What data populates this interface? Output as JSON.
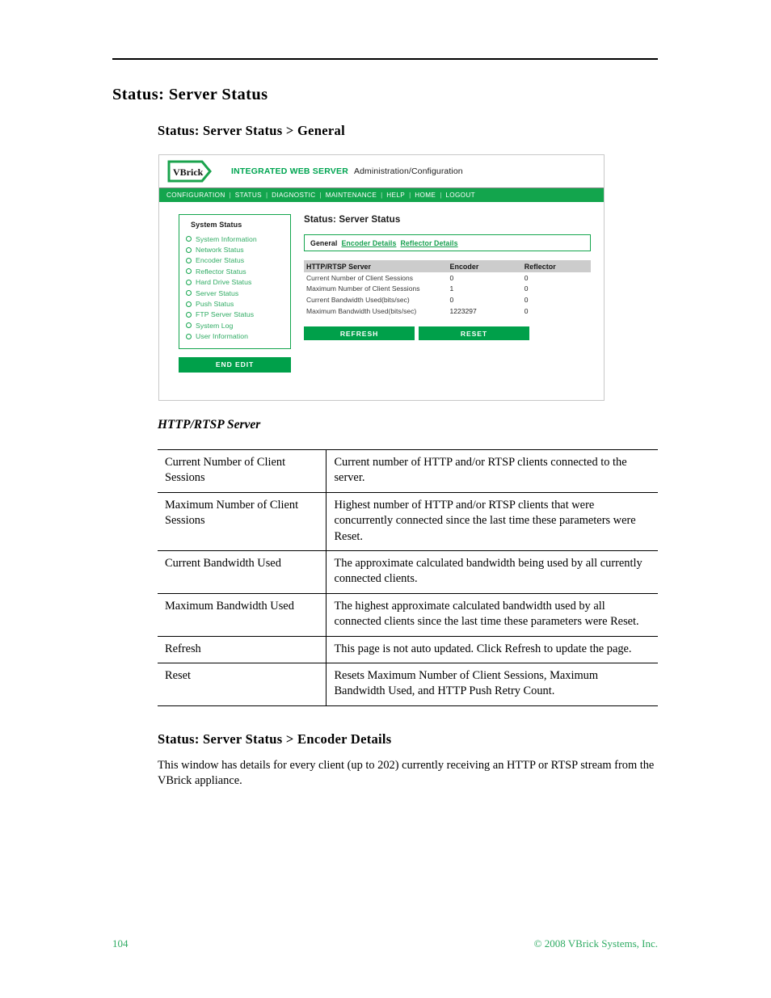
{
  "page": {
    "heading": "Status: Server Status",
    "subheading_general": "Status: Server Status > General",
    "section_http_rtsp": "HTTP/RTSP Server",
    "subheading_encoder": "Status: Server Status > Encoder Details",
    "encoder_paragraph": "This window has details for every client (up to 202) currently receiving an HTTP or RTSP stream from the VBrick appliance.",
    "footer_page_number": "104",
    "footer_copyright": "© 2008 VBrick Systems, Inc."
  },
  "colors": {
    "brand_green": "#00a551",
    "nav_green": "#13a54d",
    "button_green": "#00a04a",
    "link_green": "#16a04f",
    "sidebar_text_green": "#2fab63",
    "table_header_gray": "#cccccc"
  },
  "screenshot": {
    "header": {
      "logo_text": "VBrick",
      "title": "INTEGRATED WEB SERVER",
      "subtitle": "Administration/Configuration"
    },
    "nav_items": [
      "CONFIGURATION",
      "STATUS",
      "DIAGNOSTIC",
      "MAINTENANCE",
      "HELP",
      "HOME",
      "LOGOUT"
    ],
    "nav_separator": "|",
    "sidebar": {
      "title": "System Status",
      "items": [
        "System Information",
        "Network Status",
        "Encoder Status",
        "Reflector Status",
        "Hard Drive Status",
        "Server Status",
        "Push Status",
        "FTP Server Status",
        "System Log",
        "User Information"
      ],
      "end_edit_label": "END EDIT"
    },
    "main": {
      "title": "Status: Server Status",
      "tabs": {
        "current": "General",
        "links": [
          "Encoder Details",
          "Reflector Details"
        ]
      },
      "table": {
        "headers": [
          "HTTP/RTSP Server",
          "Encoder",
          "Reflector"
        ],
        "rows": [
          {
            "label": "Current Number of Client Sessions",
            "encoder": "0",
            "reflector": "0"
          },
          {
            "label": "Maximum Number of Client Sessions",
            "encoder": "1",
            "reflector": "0"
          },
          {
            "label": "Current Bandwidth Used(bits/sec)",
            "encoder": "0",
            "reflector": "0"
          },
          {
            "label": "Maximum Bandwidth Used(bits/sec)",
            "encoder": "1223297",
            "reflector": "0"
          }
        ]
      },
      "buttons": {
        "refresh": "REFRESH",
        "reset": "RESET"
      }
    }
  },
  "doc_table": {
    "rows": [
      {
        "term": "Current Number of Client Sessions",
        "description": "Current number of HTTP and/or RTSP clients connected to the server."
      },
      {
        "term": "Maximum Number of Client Sessions",
        "description": "Highest number of HTTP and/or RTSP clients that were concurrently connected since the last time these parameters were Reset."
      },
      {
        "term": "Current Bandwidth Used",
        "description": "The approximate calculated bandwidth being used by all currently connected clients."
      },
      {
        "term": "Maximum Bandwidth Used",
        "description": "The highest approximate calculated bandwidth used by all connected clients since the last time these parameters were Reset."
      },
      {
        "term": "Refresh",
        "description": "This page is not auto updated. Click Refresh to update the page."
      },
      {
        "term": "Reset",
        "description": "Resets Maximum Number of Client Sessions, Maximum Bandwidth Used, and HTTP Push Retry Count."
      }
    ]
  }
}
